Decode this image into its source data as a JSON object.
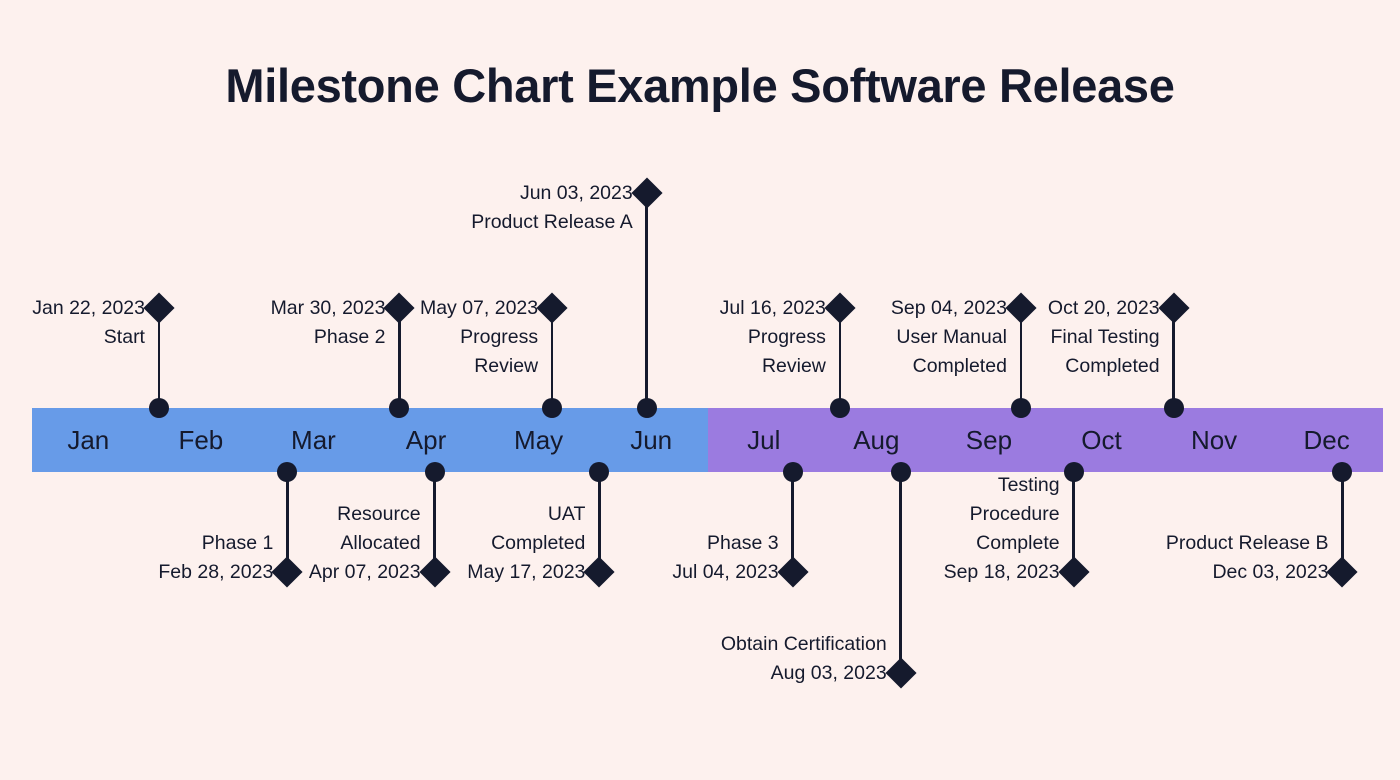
{
  "title": "Milestone Chart Example Software Release",
  "colors": {
    "background": "#fdf1ee",
    "bar_first_half": "#679be8",
    "bar_second_half": "#9b7be0",
    "marker": "#151a2d",
    "text": "#151a2d"
  },
  "axis": {
    "months": [
      "Jan",
      "Feb",
      "Mar",
      "Apr",
      "May",
      "Jun",
      "Jul",
      "Aug",
      "Sep",
      "Oct",
      "Nov",
      "Dec"
    ]
  },
  "chart_data": {
    "type": "timeline",
    "title": "Milestone Chart Example Software Release",
    "xlabel": "",
    "ylabel": "",
    "axis_categories": [
      "Jan",
      "Feb",
      "Mar",
      "Apr",
      "May",
      "Jun",
      "Jul",
      "Aug",
      "Sep",
      "Oct",
      "Nov",
      "Dec"
    ],
    "axis_segments": [
      {
        "label": "Jan - Jun",
        "color": "#679be8"
      },
      {
        "label": "Jul - Dec",
        "color": "#9b7be0"
      }
    ],
    "grid": false,
    "legend": "none",
    "milestones": [
      {
        "date": "Jan 22, 2023",
        "name": "Start",
        "side": "above",
        "x_pct": 9.4,
        "label_lines": [
          "Jan 22, 2023",
          "Start"
        ]
      },
      {
        "date": "Feb 28, 2023",
        "name": "Phase 1",
        "side": "below",
        "x_pct": 18.9,
        "label_lines": [
          "Phase 1",
          "Feb 28, 2023"
        ]
      },
      {
        "date": "Mar 30, 2023",
        "name": "Phase 2",
        "side": "above",
        "x_pct": 27.2,
        "label_lines": [
          "Mar 30, 2023",
          "Phase 2"
        ]
      },
      {
        "date": "Apr 07, 2023",
        "name": "Resource Allocated",
        "side": "below",
        "x_pct": 29.8,
        "label_lines": [
          "Resource",
          "Allocated",
          "Apr 07, 2023"
        ]
      },
      {
        "date": "May 07, 2023",
        "name": "Progress Review",
        "side": "above",
        "x_pct": 38.5,
        "label_lines": [
          "May 07, 2023",
          "Progress",
          "Review"
        ]
      },
      {
        "date": "May 17, 2023",
        "name": "UAT Completed",
        "side": "below",
        "x_pct": 42.0,
        "label_lines": [
          "UAT",
          "Completed",
          "May 17, 2023"
        ]
      },
      {
        "date": "Jun 03, 2023",
        "name": "Product Release A",
        "side": "above",
        "x_pct": 45.5,
        "label_lines": [
          "Jun 03, 2023",
          "Product Release A"
        ]
      },
      {
        "date": "Jul 04, 2023",
        "name": "Phase 3",
        "side": "below",
        "x_pct": 56.3,
        "label_lines": [
          "Phase 3",
          "Jul 04, 2023"
        ]
      },
      {
        "date": "Jul 16, 2023",
        "name": "Progress Review",
        "side": "above",
        "x_pct": 59.8,
        "label_lines": [
          "Jul 16, 2023",
          "Progress",
          "Review"
        ]
      },
      {
        "date": "Aug 03, 2023",
        "name": "Obtain Certification",
        "side": "below",
        "x_pct": 64.3,
        "label_lines": [
          "Obtain Certification",
          "Aug 03, 2023"
        ]
      },
      {
        "date": "Sep 04, 2023",
        "name": "User Manual Completed",
        "side": "above",
        "x_pct": 73.2,
        "label_lines": [
          "Sep 04, 2023",
          "User Manual",
          "Completed"
        ]
      },
      {
        "date": "Sep 18, 2023",
        "name": "Testing Procedure Complete",
        "side": "below",
        "x_pct": 77.1,
        "label_lines": [
          "Testing",
          "Procedure",
          "Complete",
          "Sep 18, 2023"
        ]
      },
      {
        "date": "Oct 20, 2023",
        "name": "Final Testing Completed",
        "side": "above",
        "x_pct": 84.5,
        "label_lines": [
          "Oct 20, 2023",
          "Final Testing",
          "Completed"
        ]
      },
      {
        "date": "Dec 03, 2023",
        "name": "Product Release B",
        "side": "below",
        "x_pct": 97.0,
        "label_lines": [
          "Product Release B",
          "Dec 03, 2023"
        ]
      }
    ]
  }
}
